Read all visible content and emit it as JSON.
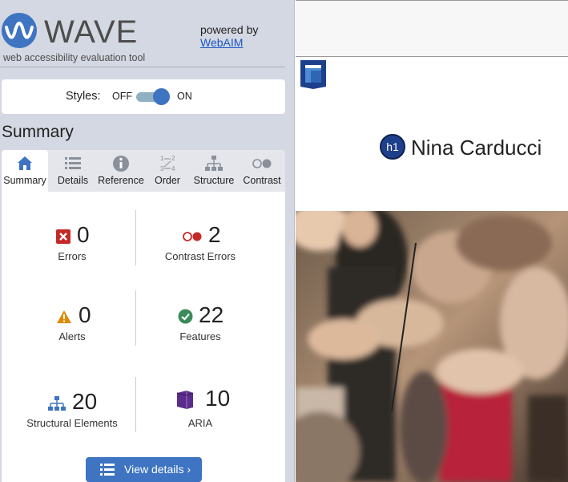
{
  "app": {
    "logo_text": "WAVE",
    "tagline": "web accessibility evaluation tool",
    "powered_by": "powered by",
    "webaim_link": "WebAIM"
  },
  "styles": {
    "label": "Styles:",
    "off": "OFF",
    "on": "ON",
    "state": "on"
  },
  "summary": {
    "title": "Summary",
    "tabs": [
      {
        "label": "Summary",
        "icon": "home-icon",
        "active": true
      },
      {
        "label": "Details",
        "icon": "list-icon",
        "active": false
      },
      {
        "label": "Reference",
        "icon": "info-icon",
        "active": false
      },
      {
        "label": "Order",
        "icon": "order-icon",
        "active": false
      },
      {
        "label": "Structure",
        "icon": "structure-icon",
        "active": false
      },
      {
        "label": "Contrast",
        "icon": "contrast-icon",
        "active": false
      }
    ],
    "stats": {
      "errors": {
        "count": "0",
        "label": "Errors"
      },
      "contrast_errors": {
        "count": "2",
        "label": "Contrast Errors"
      },
      "alerts": {
        "count": "0",
        "label": "Alerts"
      },
      "features": {
        "count": "22",
        "label": "Features"
      },
      "structural": {
        "count": "20",
        "label": "Structural Elements"
      },
      "aria": {
        "count": "10",
        "label": "ARIA"
      }
    },
    "view_details": "View details ›"
  },
  "page": {
    "h1_badge": "h1",
    "heading": "Nina Carducci"
  },
  "colors": {
    "accent": "#3e74c2",
    "error": "#c62828",
    "alert": "#e08a00",
    "feature": "#3a8a5a",
    "aria": "#5b2c8a"
  }
}
